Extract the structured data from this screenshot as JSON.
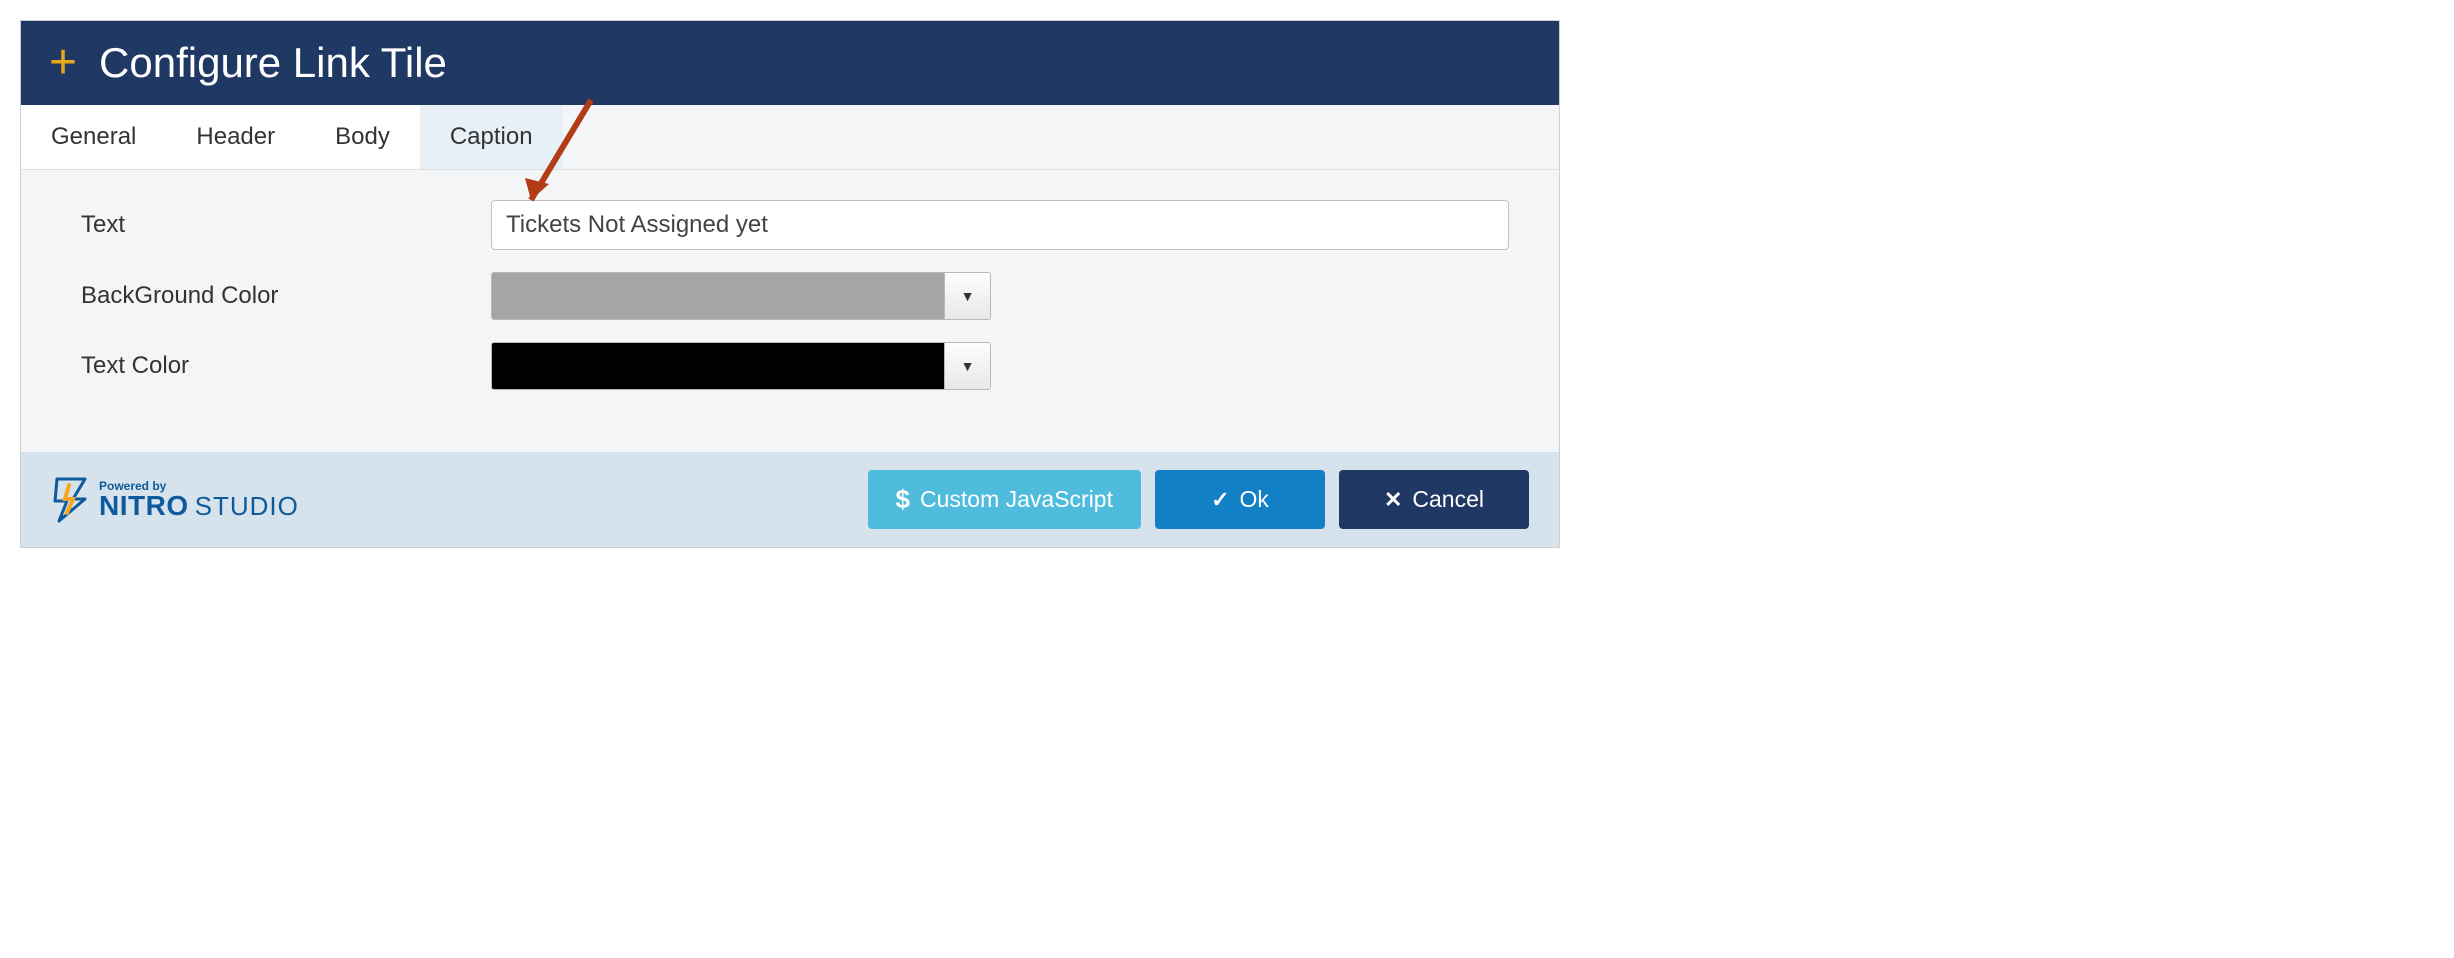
{
  "header": {
    "title": "Configure Link Tile"
  },
  "tabs": [
    {
      "label": "General",
      "active": false
    },
    {
      "label": "Header",
      "active": false
    },
    {
      "label": "Body",
      "active": false
    },
    {
      "label": "Caption",
      "active": true
    }
  ],
  "form": {
    "text_label": "Text",
    "text_value": "Tickets Not Assigned yet",
    "bg_color_label": "BackGround Color",
    "bg_color_value": "#a6a6a6",
    "text_color_label": "Text Color",
    "text_color_value": "#000000"
  },
  "footer": {
    "powered_by": "Powered by",
    "brand_bold": "NITRO",
    "brand_light": "STUDIO",
    "custom_js": "Custom JavaScript",
    "ok": "Ok",
    "cancel": "Cancel"
  }
}
